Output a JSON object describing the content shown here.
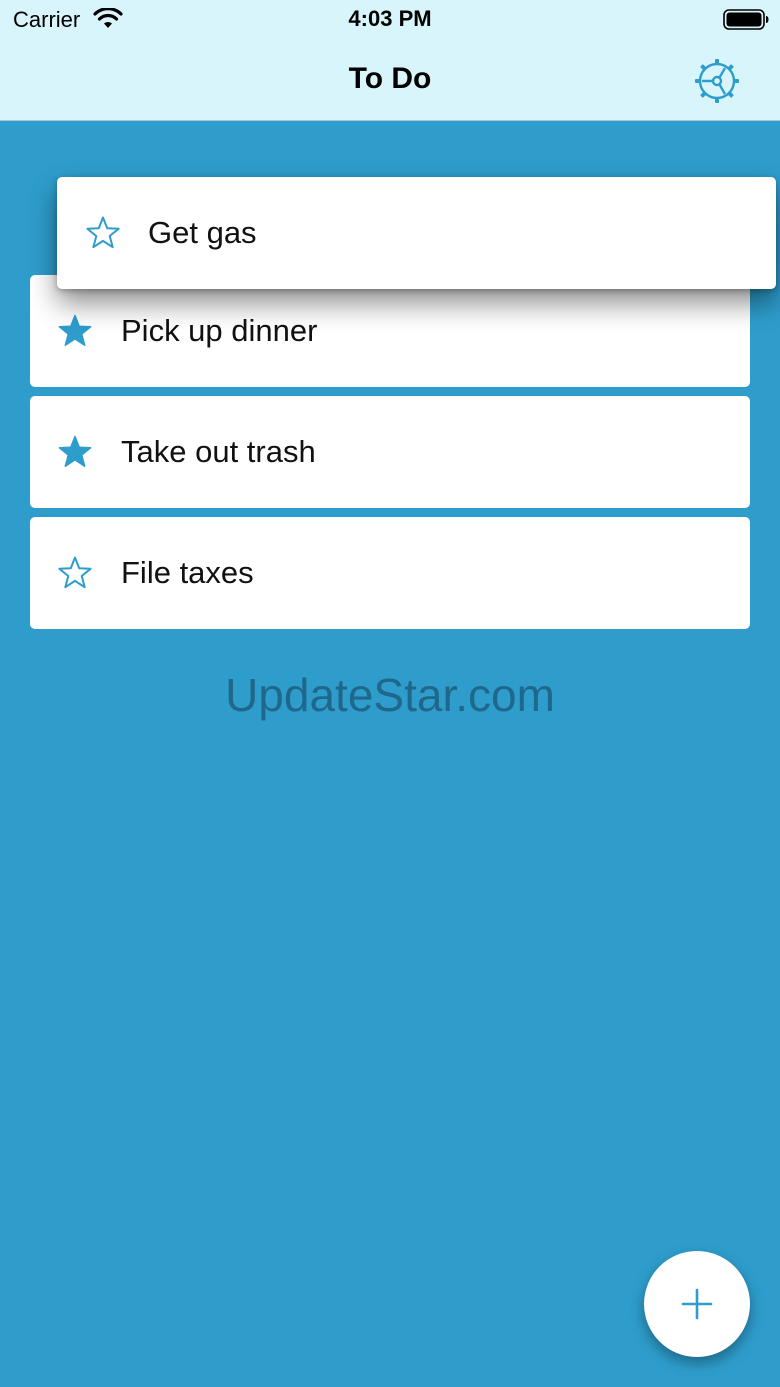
{
  "status_bar": {
    "carrier": "Carrier",
    "time": "4:03 PM",
    "icons": [
      "wifi-icon",
      "battery-icon"
    ]
  },
  "nav": {
    "title": "To Do",
    "settings_icon": "gear-icon"
  },
  "colors": {
    "background": "#2e9dcc",
    "nav_background": "#d8f5fb",
    "accent": "#2e9dcc",
    "card": "#ffffff"
  },
  "dragging_item": {
    "label": "Get gas",
    "starred": false
  },
  "items": [
    {
      "label": "Pick up dinner",
      "starred": true
    },
    {
      "label": "Take out trash",
      "starred": true
    },
    {
      "label": "File taxes",
      "starred": false
    }
  ],
  "watermark": "UpdateStar.com",
  "fab": {
    "icon": "plus-icon"
  }
}
